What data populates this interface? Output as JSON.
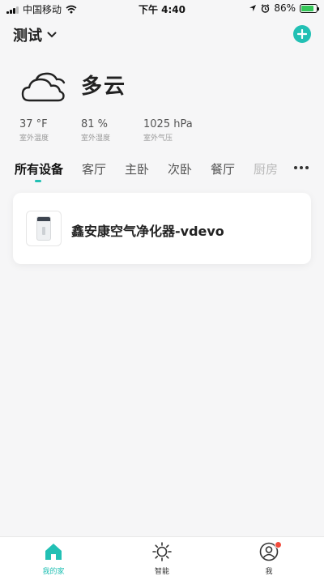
{
  "status_bar": {
    "carrier": "中国移动",
    "time": "下午 4:40",
    "battery": "86%",
    "battery_level": 0.86
  },
  "header": {
    "home_name": "测试"
  },
  "weather": {
    "condition": "多云",
    "stats": [
      {
        "value": "37 °F",
        "label": "室外温度"
      },
      {
        "value": "81 %",
        "label": "室外湿度"
      },
      {
        "value": "1025 hPa",
        "label": "室外气压"
      }
    ]
  },
  "tabs": [
    "所有设备",
    "客厅",
    "主卧",
    "次卧",
    "餐厅",
    "厨房"
  ],
  "active_tab": "所有设备",
  "devices": [
    {
      "name": "鑫安康空气净化器-vdevo"
    }
  ],
  "bottom_nav": [
    {
      "label": "我的家",
      "icon": "home-icon"
    },
    {
      "label": "智能",
      "icon": "sun-icon"
    },
    {
      "label": "我",
      "icon": "profile-icon"
    }
  ],
  "colors": {
    "accent": "#22c0b4",
    "background": "#f6f6f7",
    "badge": "#f24b3c",
    "battery": "#35c759"
  }
}
